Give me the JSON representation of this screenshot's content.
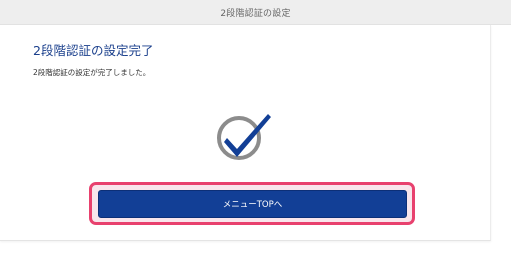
{
  "header": {
    "title": "2段階認証の設定"
  },
  "main": {
    "title": "2段階認証の設定完了",
    "message": "2段階認証の設定が完了しました。",
    "status_icon": "checkmark-icon",
    "button_label": "メニューTOPへ"
  },
  "colors": {
    "title_blue": "#1a3f8c",
    "button_blue": "#123f96",
    "highlight_pink": "#e8416e",
    "check_gray": "#8c8c8c"
  }
}
